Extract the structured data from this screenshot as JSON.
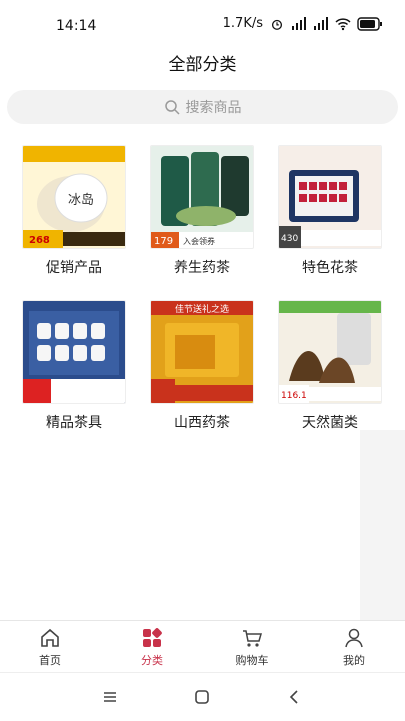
{
  "status_bar": {
    "time": "14:14",
    "network_speed": "1.7K/s",
    "battery_icon": "battery-icon",
    "wifi_icon": "wifi-icon"
  },
  "header": {
    "title": "全部分类"
  },
  "search": {
    "placeholder": "搜索商品"
  },
  "categories": [
    {
      "label": "促销产品",
      "thumb_text": "冰岛",
      "accent": "#f0b400"
    },
    {
      "label": "养生药茶",
      "thumb_text": "179",
      "accent": "#2e6b4f"
    },
    {
      "label": "特色花茶",
      "thumb_text": "430",
      "accent": "#c2203a"
    },
    {
      "label": "精品茶具",
      "thumb_text": "",
      "accent": "#2b4c8c"
    },
    {
      "label": "山西药茶",
      "thumb_text": "佳节送礼之选",
      "accent": "#e2a11a"
    },
    {
      "label": "天然菌类",
      "thumb_text": "116.1",
      "accent": "#5a3b1e"
    }
  ],
  "tabbar": {
    "items": [
      {
        "label": "首页",
        "icon": "home-icon"
      },
      {
        "label": "分类",
        "icon": "category-icon",
        "active": true
      },
      {
        "label": "购物车",
        "icon": "cart-icon"
      },
      {
        "label": "我的",
        "icon": "user-icon"
      }
    ],
    "active_color": "#c8324a"
  }
}
